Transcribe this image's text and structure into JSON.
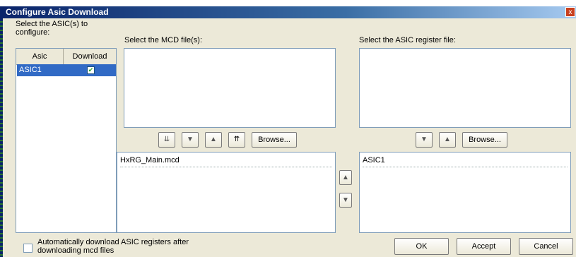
{
  "window": {
    "title": "Configure Asic Download",
    "close_glyph": "x"
  },
  "asic_section": {
    "label": "Select the ASIC(s) to configure:",
    "columns": [
      "Asic",
      "Download"
    ],
    "rows": [
      {
        "asic": "ASIC1",
        "download_checked": true
      }
    ]
  },
  "mcd_section": {
    "label": "Select the MCD file(s):",
    "buttons": {
      "move_bottom_icon": "move-bottom-icon",
      "move_down_icon": "arrow-down-icon",
      "move_up_icon": "arrow-up-icon",
      "move_top_icon": "move-top-icon",
      "browse_label": "Browse..."
    },
    "selected_files": [
      "HxRG_Main.mcd"
    ]
  },
  "register_section": {
    "label": "Select the ASIC register file:",
    "buttons": {
      "browse_label": "Browse..."
    },
    "selected_files": [
      "ASIC1"
    ]
  },
  "footer": {
    "auto_download_label": "Automatically download ASIC registers after downloading mcd files",
    "auto_download_checked": false,
    "ok_label": "OK",
    "accept_label": "Accept",
    "cancel_label": "Cancel"
  },
  "colors": {
    "title_bar": "#0a246a",
    "selection": "#316ac5",
    "dialog_bg": "#ece9d8"
  }
}
